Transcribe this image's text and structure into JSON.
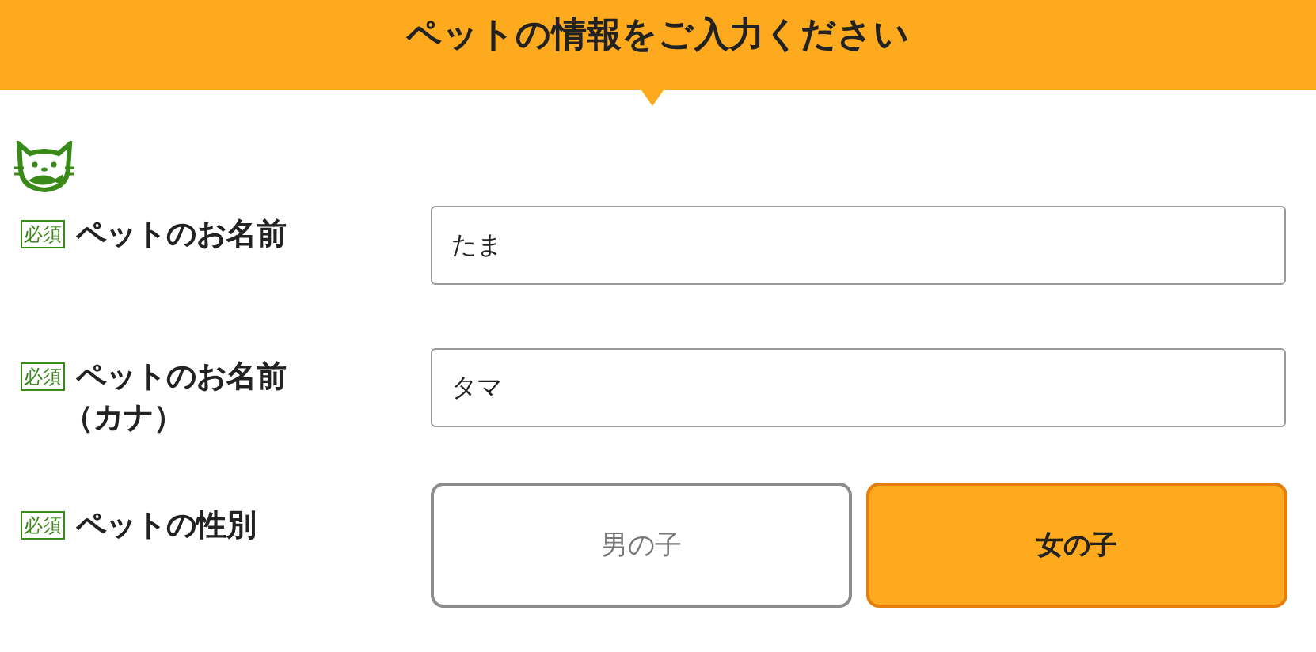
{
  "header": {
    "title": "ペットの情報をご入力ください"
  },
  "fields": [
    {
      "kind": "text",
      "required_badge": "必須",
      "label": "ペットのお名前",
      "value": "たま"
    },
    {
      "kind": "text",
      "required_badge": "必須",
      "label": "ペットのお名前",
      "label_note": "（カナ）",
      "value": "タマ"
    },
    {
      "kind": "choice",
      "required_badge": "必須",
      "label": "ペットの性別",
      "options": [
        {
          "label": "男の子",
          "selected": false
        },
        {
          "label": "女の子",
          "selected": true
        }
      ]
    }
  ]
}
